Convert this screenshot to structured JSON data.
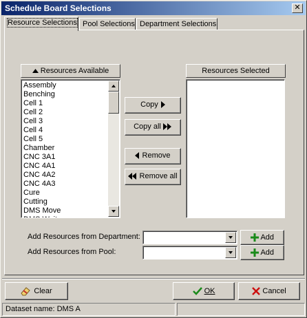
{
  "window": {
    "title": "Schedule Board Selections",
    "close_glyph": "✕"
  },
  "tabs": [
    {
      "label": "Resource Selections",
      "active": true
    },
    {
      "label": "Pool Selections",
      "active": false
    },
    {
      "label": "Department Selections",
      "active": false
    }
  ],
  "available": {
    "header": "Resources Available",
    "items": [
      "Assembly",
      "Benching",
      "Cell 1",
      "Cell 2",
      "Cell 3",
      "Cell 4",
      "Cell 5",
      "Chamber",
      "CNC 3A1",
      "CNC 4A1",
      "CNC 4A2",
      "CNC 4A3",
      "Cure",
      "Cutting",
      "DMS Move",
      "DMS Wait"
    ]
  },
  "selected": {
    "header": "Resources Selected",
    "items": []
  },
  "actions": {
    "copy": "Copy",
    "copy_all": "Copy all",
    "remove": "Remove",
    "remove_all": "Remove all"
  },
  "add_from": {
    "department_label": "Add Resources from Department:",
    "department_value": "",
    "pool_label": "Add Resources from Pool:",
    "pool_value": "",
    "add_label": "Add"
  },
  "footer": {
    "clear": "Clear",
    "ok": "OK",
    "cancel": "Cancel"
  },
  "status": {
    "dataset": "Dataset name:  DMS A",
    "extra": ""
  },
  "icons": {
    "up_arrow": "triangle-up-icon",
    "play": "triangle-right-icon",
    "double_play": "double-triangle-right-icon",
    "back": "triangle-left-icon",
    "double_back": "double-triangle-left-icon",
    "plus": "green-plus-icon",
    "check": "green-check-icon",
    "x": "red-x-icon",
    "eraser": "eraser-icon"
  }
}
